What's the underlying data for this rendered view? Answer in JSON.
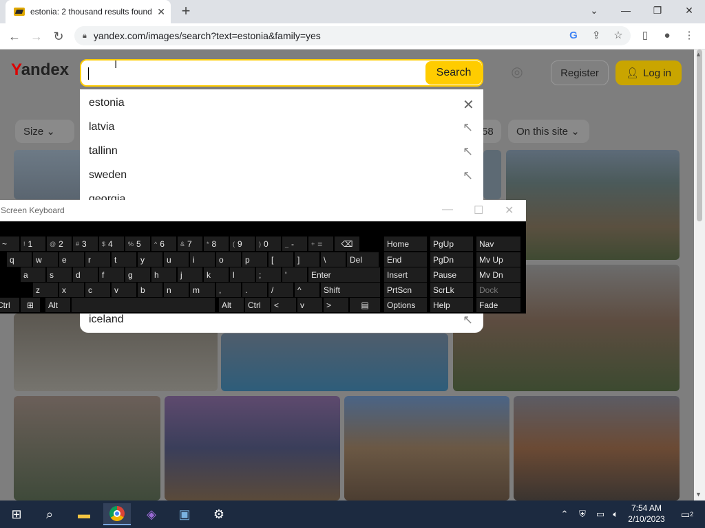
{
  "browser": {
    "tab_title": "estonia: 2 thousand results found",
    "url": "yandex.com/images/search?text=estonia&family=yes",
    "new_tab": "+",
    "tab_close": "✕"
  },
  "header": {
    "logo_y": "Y",
    "logo_rest": "andex",
    "search_button": "Search",
    "register": "Register",
    "login": "Log in"
  },
  "filters": {
    "size": "Size",
    "on_this_site": "On this site",
    "partial": "58"
  },
  "suggestions": [
    "estonia",
    "latvia",
    "tallinn",
    "sweden",
    "georgia",
    "iceland"
  ],
  "osk": {
    "title": "Screen Keyboard",
    "row1": [
      "~",
      "1",
      "2",
      "3",
      "4",
      "5",
      "6",
      "7",
      "8",
      "9",
      "0",
      "-",
      "=",
      "⌫"
    ],
    "row1_shift": [
      "`",
      "!",
      "@",
      "#",
      "$",
      "%",
      "^",
      "&",
      "*",
      "(",
      ")",
      "_",
      "+"
    ],
    "row2": [
      "q",
      "w",
      "e",
      "r",
      "t",
      "y",
      "u",
      "i",
      "o",
      "p",
      "[",
      "]",
      "\\",
      "Del"
    ],
    "row3": [
      "a",
      "s",
      "d",
      "f",
      "g",
      "h",
      "j",
      "k",
      "l",
      ";",
      "'",
      "Enter"
    ],
    "row4": [
      "z",
      "x",
      "c",
      "v",
      "b",
      "n",
      "m",
      ",",
      ".",
      "/",
      "^",
      "Shift"
    ],
    "row5": [
      "Ctrl",
      "Alt",
      "Alt",
      "Ctrl",
      "<",
      "v",
      ">"
    ],
    "nav": [
      "Home",
      "PgUp",
      "Nav",
      "End",
      "PgDn",
      "Mv Up",
      "Insert",
      "Pause",
      "Mv Dn",
      "PrtScn",
      "ScrLk",
      "Dock",
      "Options",
      "Help",
      "Fade"
    ]
  },
  "taskbar": {
    "time": "7:54 AM",
    "date": "2/10/2023",
    "notifications": "2"
  },
  "colors": {
    "accent": "#ffcc00",
    "taskbar": "#1c2a40"
  }
}
